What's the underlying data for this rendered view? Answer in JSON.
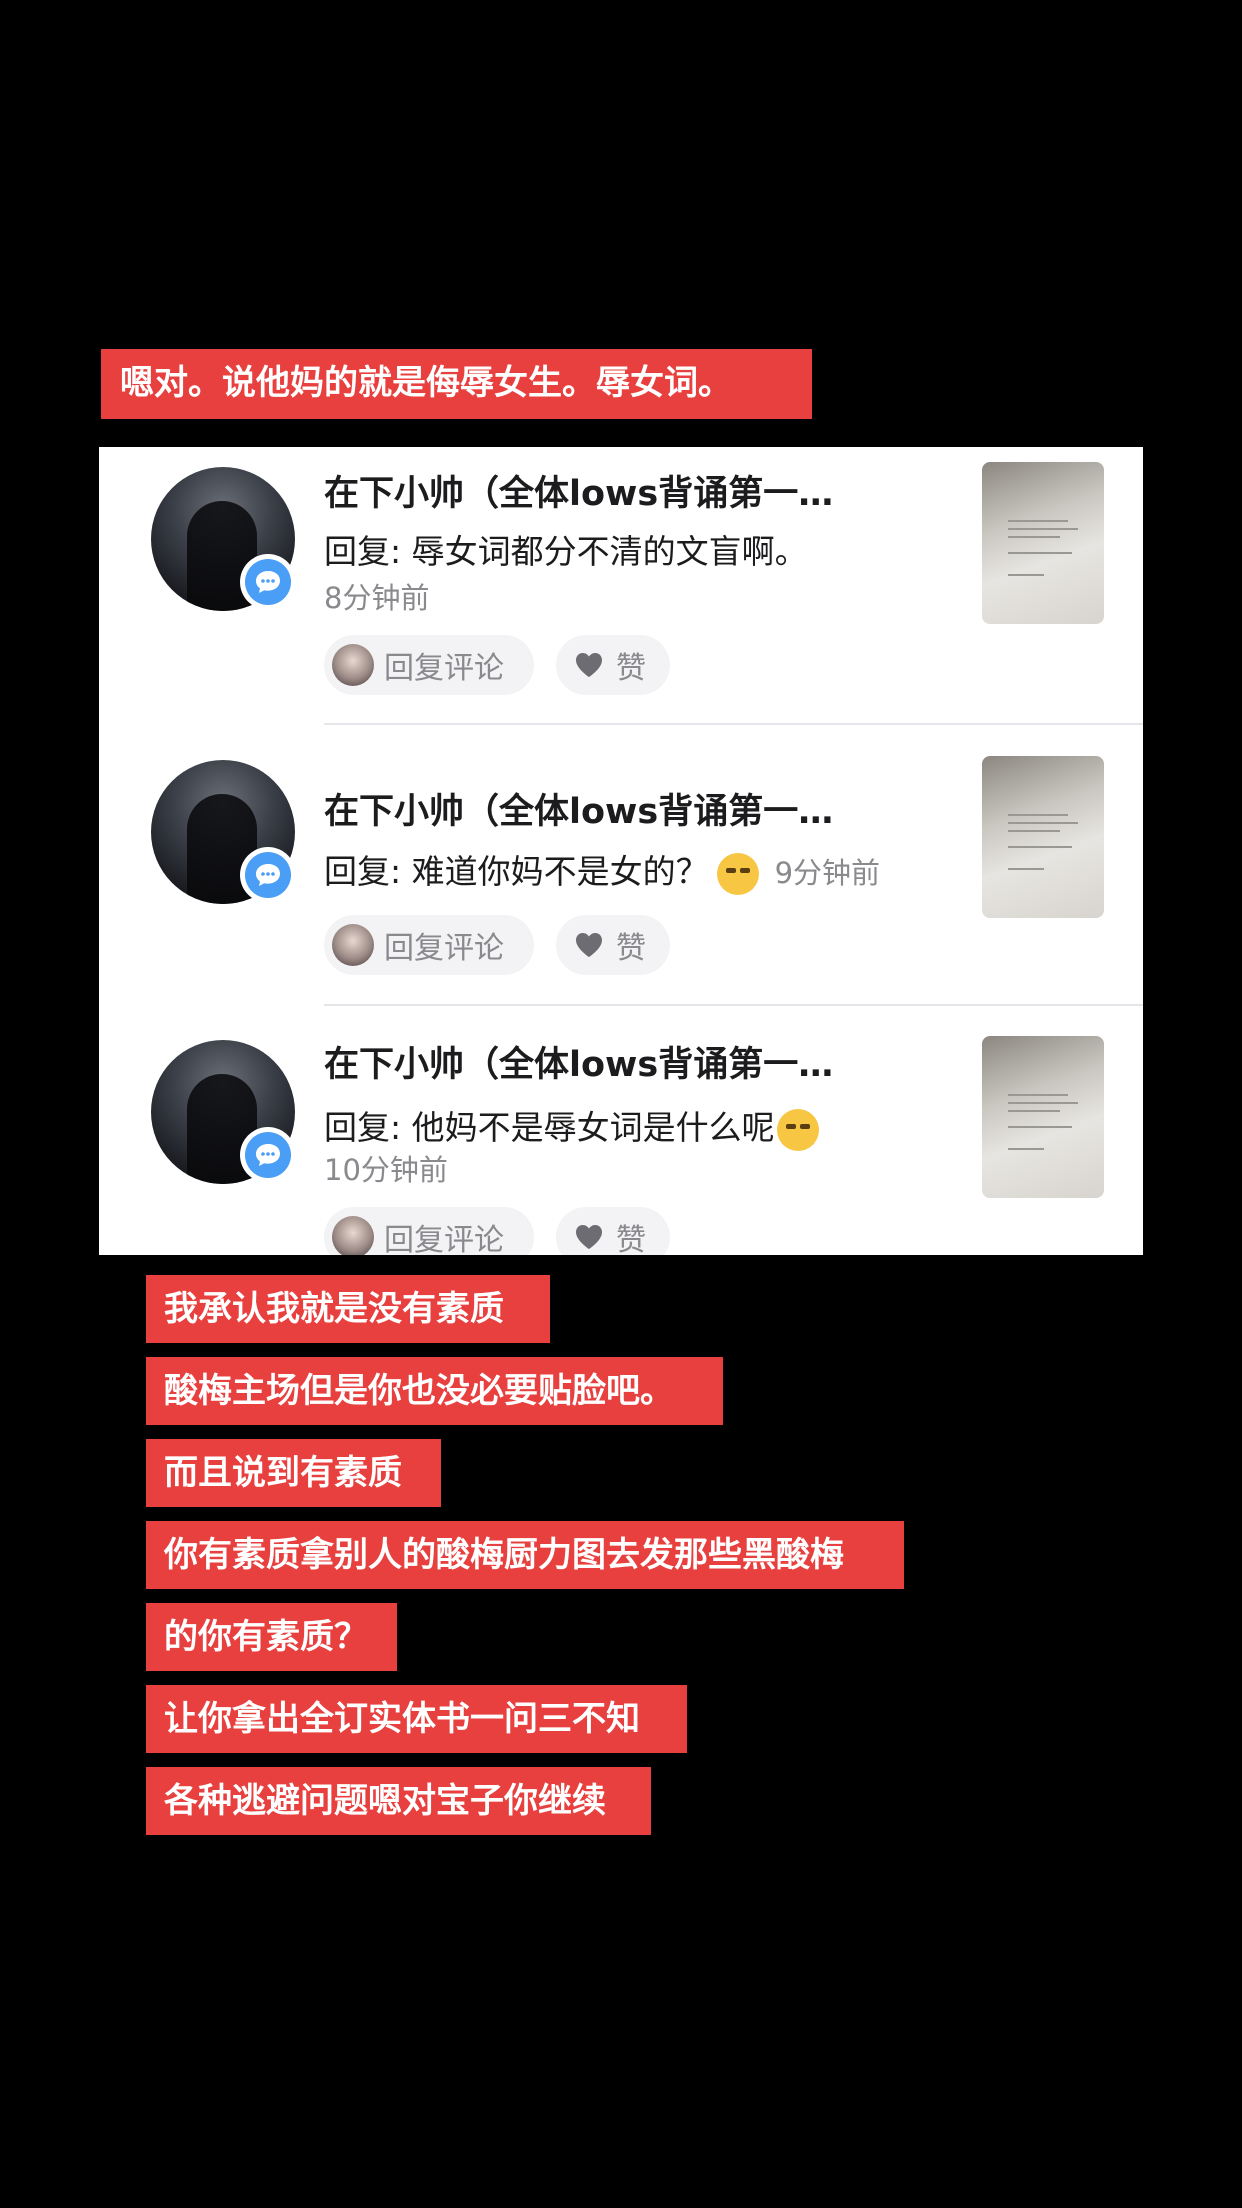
{
  "headline": "嗯对。说他妈的就是侮辱女生。辱女词。",
  "comments": [
    {
      "author": "在下小帅（全体lows背诵第一…",
      "reply": "回复: 辱女词都分不清的文盲啊。",
      "time": "8分钟前",
      "reply_button": "回复评论",
      "like_button": "赞"
    },
    {
      "author": "在下小帅（全体lows背诵第一…",
      "reply": "回复: 难道你妈不是女的？",
      "time": "9分钟前",
      "reply_button": "回复评论",
      "like_button": "赞"
    },
    {
      "author": "在下小帅（全体lows背诵第一…",
      "reply": "回复: 他妈不是辱女词是什么呢",
      "time": "10分钟前",
      "reply_button": "回复评论",
      "like_button": "赞"
    }
  ],
  "captions": [
    "我承认我就是没有素质",
    "酸梅主场但是你也没必要贴脸吧。",
    "而且说到有素质",
    "你有素质拿别人的酸梅厨力图去发那些黑酸梅",
    "的你有素质？",
    "让你拿出全订实体书一问三不知",
    "各种逃避问题嗯对宝子你继续"
  ],
  "icons": {
    "badge": "chat-bubble-icon",
    "like": "heart-icon",
    "emoji": "rolling-eyes-emoji-icon"
  },
  "colors": {
    "label_bg": "#e8403f",
    "badge_blue": "#4a9ef5",
    "background": "#000000"
  }
}
